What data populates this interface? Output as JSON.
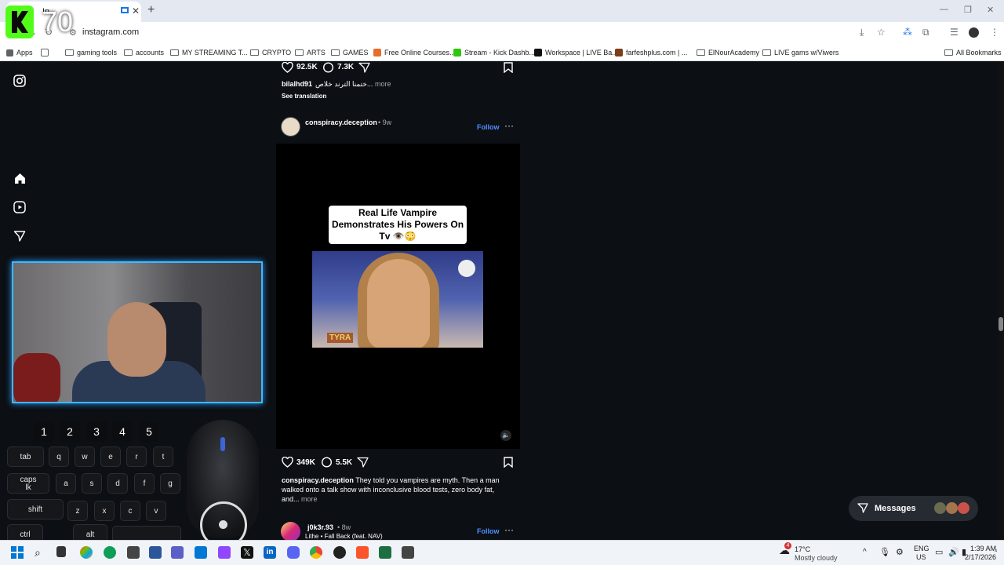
{
  "browser": {
    "tab_title": "In...",
    "url": "instagram.com",
    "bookmarks": [
      {
        "label": "Apps",
        "kind": "apps"
      },
      {
        "label": "gaming tools",
        "kind": "folder"
      },
      {
        "label": "accounts",
        "kind": "folder"
      },
      {
        "label": "MY STREAMING T...",
        "kind": "folder"
      },
      {
        "label": "CRYPTO",
        "kind": "folder"
      },
      {
        "label": "ARTS",
        "kind": "folder"
      },
      {
        "label": "GAMES",
        "kind": "folder"
      },
      {
        "label": "Free Online Courses...",
        "kind": "site"
      },
      {
        "label": "Stream - Kick Dashb...",
        "kind": "site"
      },
      {
        "label": "Workspace | LIVE Ba...",
        "kind": "site"
      },
      {
        "label": "farfeshplus.com | ...",
        "kind": "site"
      },
      {
        "label": "ElNourAcademy",
        "kind": "folder"
      },
      {
        "label": "LIVE gams w/Viwers",
        "kind": "folder"
      }
    ],
    "all_bookmarks": "All Bookmarks"
  },
  "overlay": {
    "badge_text": "70",
    "number_keys": [
      "1",
      "2",
      "3",
      "4",
      "5"
    ],
    "keys": {
      "tab": "tab",
      "q": "q",
      "w": "w",
      "e": "e",
      "r": "r",
      "t": "t",
      "caps": "caps\nlk",
      "a": "a",
      "s": "s",
      "d": "d",
      "f": "f",
      "g": "g",
      "shift": "shift",
      "z": "z",
      "x": "x",
      "c": "c",
      "v": "v",
      "ctrl": "ctrl",
      "alt": "alt"
    }
  },
  "feed": {
    "prev_post": {
      "likes": "92.5K",
      "comments": "7.3K",
      "username": "bilalhd91",
      "caption": "ختمنا الترند خلاص...",
      "more": "more",
      "see_translation": "See translation"
    },
    "post": {
      "username": "conspiracy.deception",
      "age": "• 9w",
      "follow": "Follow",
      "video_caption": "Real Life Vampire Demonstrates His Powers On Tv 👁️😳",
      "video_tag": "TYRA",
      "likes": "349K",
      "comments": "5.5K",
      "caption_user": "conspiracy.deception",
      "caption": "They told you vampires are myth. Then a man walked onto a talk show with inconclusive blood tests, zero body fat, and...",
      "more": "more"
    },
    "next_post": {
      "username": "j0k3r.93",
      "age": "• 8w",
      "audio": "Lithe • Fall Back (feat. NAV)",
      "follow": "Follow"
    },
    "messages": "Messages"
  },
  "taskbar": {
    "weather_temp": "17°C",
    "weather_desc": "Mostly cloudy",
    "weather_badge": "4",
    "lang": "ENG",
    "region": "US",
    "time": "1:39 AM",
    "date": "2/17/2026"
  },
  "colors": {
    "accent_blue": "#4d8fff",
    "cam_border": "#3fb8ff",
    "ig_bg": "#0c0f14"
  }
}
